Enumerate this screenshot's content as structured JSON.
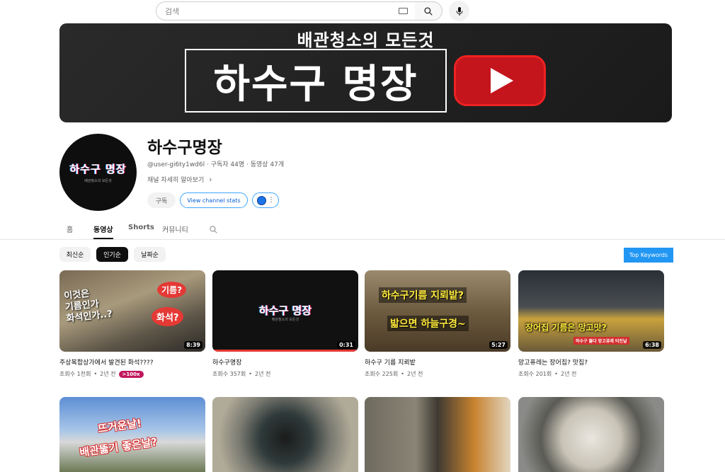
{
  "search": {
    "placeholder": "검색"
  },
  "banner": {
    "subtitle": "배관청소의 모든것",
    "title": "하수구 명장"
  },
  "channel": {
    "avatar_text": "하수구 명장",
    "avatar_subtext": "배관청소의 모든것",
    "name": "하수구명장",
    "handle": "@user-gi6ty1wd6l",
    "subscribers": "구독자 44명",
    "video_count": "동영상 47개",
    "more_label": "채널 자세히 알아보기",
    "subscribe_label": "구독",
    "stats_label": "View channel stats"
  },
  "tabs": [
    "홈",
    "동영상",
    "Shorts",
    "커뮤니티"
  ],
  "chips": [
    "최신순",
    "인기순",
    "날짜순"
  ],
  "top_keywords": "Top Keywords",
  "videos": [
    {
      "title": "주상복합상가에서 발견된 화석????",
      "views": "조회수 1천회",
      "age": "2년 전",
      "badge": ">100x",
      "duration": "8:39",
      "overlay": [
        "이것은",
        "기름인가",
        "화석인가..?",
        "기름?",
        "화석?"
      ]
    },
    {
      "title": "하수구명장",
      "views": "조회수 357회",
      "age": "2년 전",
      "duration": "0:31",
      "overlay": [
        "하수구 명장",
        "배관청소의 모든것"
      ]
    },
    {
      "title": "하수구 기름 지뢰밭",
      "views": "조회수 225회",
      "age": "2년 전",
      "duration": "5:27",
      "overlay": [
        "하수구기름 지뢰밭?",
        "밟으면 하늘구경~"
      ]
    },
    {
      "title": "망고퓨레는 장어집? 맛집?",
      "views": "조회수 201회",
      "age": "2년 전",
      "duration": "6:38",
      "overlay": [
        "장어집 기름은 망고맛?",
        "하수구 뚫다 망고퓨레 터진날"
      ]
    },
    {
      "title": "",
      "views": "",
      "age": "",
      "duration": "",
      "overlay": [
        "뜨거운날!",
        "배관뚫기 좋은날?"
      ]
    },
    {
      "title": "",
      "views": "",
      "age": "",
      "duration": "",
      "overlay": []
    },
    {
      "title": "",
      "views": "",
      "age": "",
      "duration": "",
      "overlay": []
    },
    {
      "title": "",
      "views": "",
      "age": "",
      "duration": "",
      "overlay": []
    }
  ],
  "colors": {
    "accent": "#2196f3",
    "badge": "#c0175d",
    "youtube_red": "#c4151c"
  }
}
